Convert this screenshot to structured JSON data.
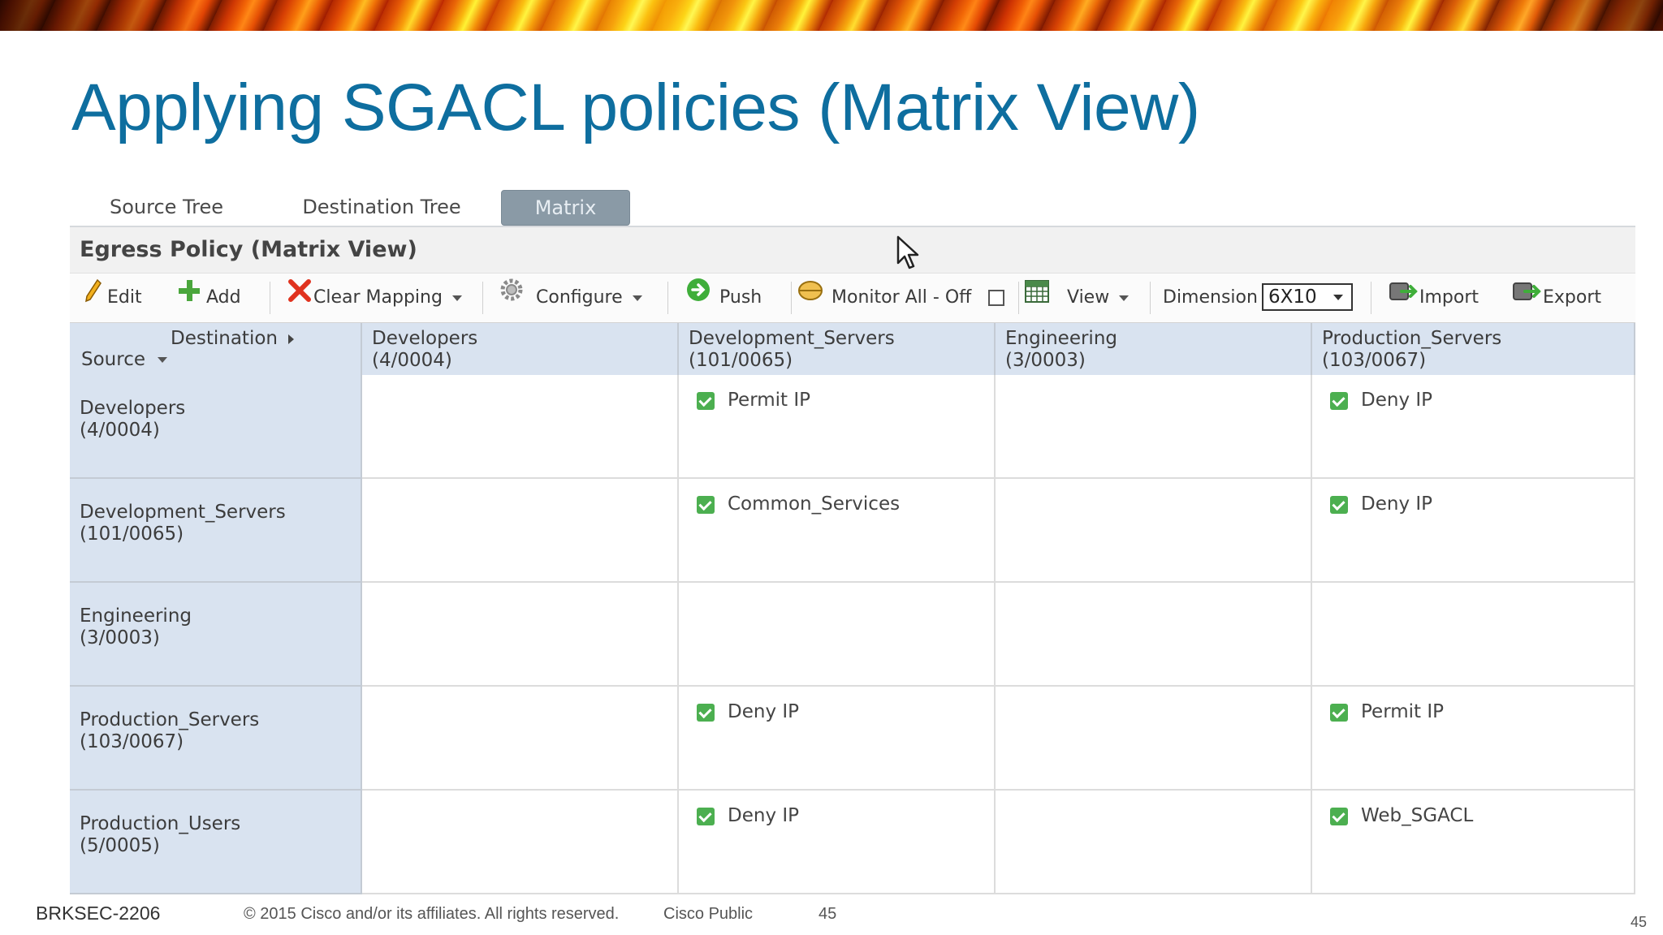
{
  "slide": {
    "title": "Applying SGACL policies (Matrix View)"
  },
  "tabs": [
    {
      "label": "Source Tree",
      "active": false
    },
    {
      "label": "Destination Tree",
      "active": false
    },
    {
      "label": "Matrix",
      "active": true
    }
  ],
  "panel": {
    "title": "Egress Policy (Matrix View)"
  },
  "toolbar": {
    "edit": "Edit",
    "add": "Add",
    "clear_mapping": "Clear Mapping",
    "configure": "Configure",
    "push": "Push",
    "monitor_all": "Monitor All - Off",
    "view": "View",
    "dimension_label": "Dimension",
    "dimension_value": "6X10",
    "import": "Import",
    "export": "Export"
  },
  "matrix": {
    "corner": {
      "destination": "Destination",
      "source": "Source"
    },
    "columns": [
      {
        "name": "Developers",
        "tag": "(4/0004)"
      },
      {
        "name": "Development_Servers",
        "tag": "(101/0065)"
      },
      {
        "name": "Engineering",
        "tag": "(3/0003)"
      },
      {
        "name": "Production_Servers",
        "tag": "(103/0067)"
      }
    ],
    "rows": [
      {
        "name": "Developers",
        "tag": "(4/0004)",
        "cells": [
          "",
          "Permit IP",
          "",
          "Deny IP"
        ]
      },
      {
        "name": "Development_Servers",
        "tag": "(101/0065)",
        "cells": [
          "",
          "Common_Services",
          "",
          "Deny IP"
        ]
      },
      {
        "name": "Engineering",
        "tag": "(3/0003)",
        "cells": [
          "",
          "",
          "",
          ""
        ]
      },
      {
        "name": "Production_Servers",
        "tag": "(103/0067)",
        "cells": [
          "",
          "Deny IP",
          "",
          "Permit IP"
        ]
      },
      {
        "name": "Production_Users",
        "tag": "(5/0005)",
        "cells": [
          "",
          "Deny IP",
          "",
          "Web_SGACL"
        ]
      }
    ]
  },
  "footer": {
    "session": "BRKSEC-2206",
    "copyright": "© 2015 Cisco and/or its affiliates. All rights reserved.",
    "classification": "Cisco Public",
    "page_inline": "45",
    "page_corner": "45"
  },
  "colors": {
    "title": "#0e6e9f",
    "header_bg": "#d9e3f0",
    "check": "#4caf50",
    "clear_x": "#e0321e"
  }
}
